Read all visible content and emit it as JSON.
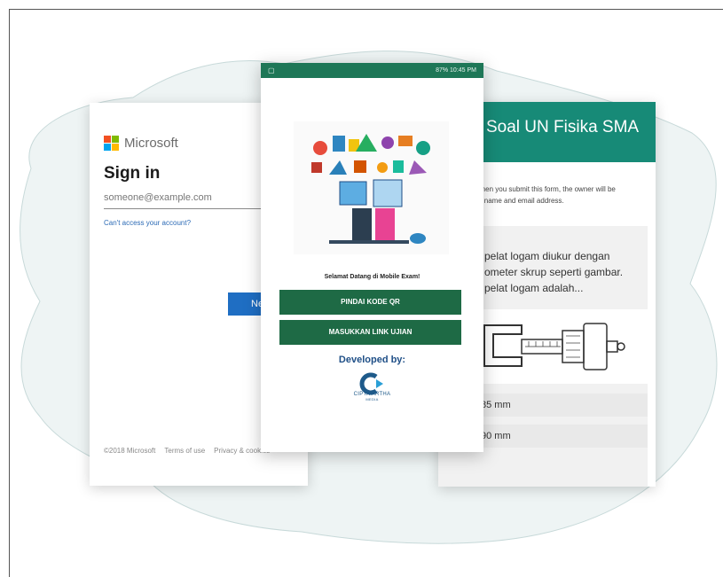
{
  "microsoft": {
    "brand": "Microsoft",
    "heading": "Sign in",
    "email_placeholder": "someone@example.com",
    "help_link": "Can't access your account?",
    "next_button": "Ne",
    "footer": {
      "copyright": "©2018 Microsoft",
      "terms": "Terms of use",
      "privacy": "Privacy & cookies"
    },
    "logo_colors": [
      "#f25022",
      "#7fba00",
      "#00a4ef",
      "#ffb900"
    ]
  },
  "form": {
    "title": "Soal UN Fisika SMA",
    "note_line1": "a, when you submit this form, the owner will be",
    "note_line2": "your name and email address.",
    "question_line1": "pelat logam diukur dengan",
    "question_line2": "ometer skrup seperti gambar.",
    "question_line3": "pelat logam adalah...",
    "options": [
      "85 mm",
      "90 mm"
    ],
    "header_color": "#178a77"
  },
  "phone": {
    "status_bar": "87% 10:45 PM",
    "welcome": "Selamat Datang di Mobile Exam!",
    "scan_button": "PINDAI KODE QR",
    "link_button": "MASUKKAN LINK UJIAN",
    "developed_by": "Developed by:",
    "company": "CIPTA ARTHA",
    "company_sub": "MEDIA",
    "accent_color": "#1e6a45"
  }
}
